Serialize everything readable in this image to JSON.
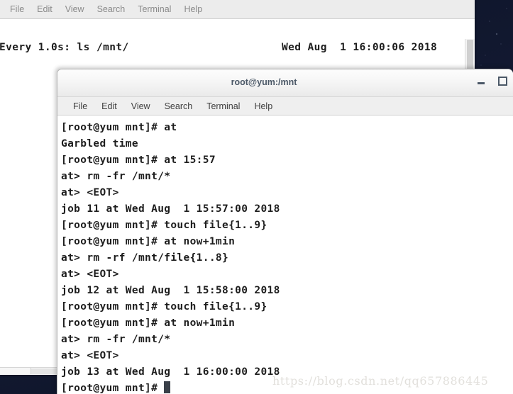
{
  "desktop": {
    "background_color": "#10162b"
  },
  "back_window": {
    "name": "watch-terminal",
    "menu": [
      "File",
      "Edit",
      "View",
      "Search",
      "Terminal",
      "Help"
    ],
    "watch_command": "Every 1.0s: ls /mnt/",
    "watch_timestamp": "Wed Aug  1 16:00:06 2018"
  },
  "front_window": {
    "name": "root-terminal",
    "title": "root@yum:/mnt",
    "menu": [
      "File",
      "Edit",
      "View",
      "Search",
      "Terminal",
      "Help"
    ],
    "buttons": {
      "minimize": "–",
      "maximize": "□"
    },
    "terminal_lines": [
      "[root@yum mnt]# at",
      "Garbled time",
      "[root@yum mnt]# at 15:57",
      "at> rm -fr /mnt/*",
      "at> <EOT>",
      "job 11 at Wed Aug  1 15:57:00 2018",
      "[root@yum mnt]# touch file{1..9}",
      "[root@yum mnt]# at now+1min",
      "at> rm -rf /mnt/file{1..8}",
      "at> <EOT>",
      "job 12 at Wed Aug  1 15:58:00 2018",
      "[root@yum mnt]# touch file{1..9}",
      "[root@yum mnt]# at now+1min",
      "at> rm -fr /mnt/*",
      "at> <EOT>",
      "job 13 at Wed Aug  1 16:00:00 2018"
    ],
    "prompt": "[root@yum mnt]# "
  },
  "watermark": "https://blog.csdn.net/qq657886445"
}
